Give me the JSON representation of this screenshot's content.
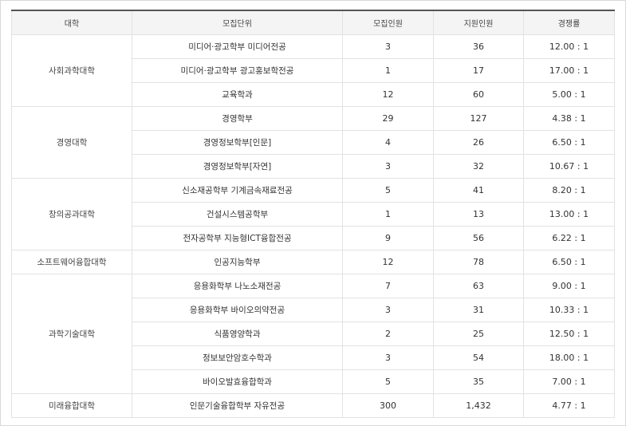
{
  "headers": [
    "대학",
    "모집단위",
    "모집인원",
    "지원인원",
    "경쟁률"
  ],
  "groups": [
    {
      "college": "사회과학대학",
      "rows": [
        {
          "unit": "미디어·광고학부 미디어전공",
          "quota": "3",
          "applicants": "36",
          "ratio": "12.00 : 1"
        },
        {
          "unit": "미디어·광고학부 광고홍보학전공",
          "quota": "1",
          "applicants": "17",
          "ratio": "17.00 : 1"
        },
        {
          "unit": "교육학과",
          "quota": "12",
          "applicants": "60",
          "ratio": "5.00 : 1"
        }
      ]
    },
    {
      "college": "경영대학",
      "rows": [
        {
          "unit": "경영학부",
          "quota": "29",
          "applicants": "127",
          "ratio": "4.38 : 1"
        },
        {
          "unit": "경영정보학부[인문]",
          "quota": "4",
          "applicants": "26",
          "ratio": "6.50 : 1"
        },
        {
          "unit": "경영정보학부[자연]",
          "quota": "3",
          "applicants": "32",
          "ratio": "10.67 : 1"
        }
      ]
    },
    {
      "college": "창의공과대학",
      "rows": [
        {
          "unit": "신소재공학부 기계금속재료전공",
          "quota": "5",
          "applicants": "41",
          "ratio": "8.20 : 1"
        },
        {
          "unit": "건설시스템공학부",
          "quota": "1",
          "applicants": "13",
          "ratio": "13.00 : 1"
        },
        {
          "unit": "전자공학부 지능형ICT융합전공",
          "quota": "9",
          "applicants": "56",
          "ratio": "6.22 : 1"
        }
      ]
    },
    {
      "college": "소프트웨어융합대학",
      "rows": [
        {
          "unit": "인공지능학부",
          "quota": "12",
          "applicants": "78",
          "ratio": "6.50 : 1"
        }
      ]
    },
    {
      "college": "과학기술대학",
      "rows": [
        {
          "unit": "응용화학부 나노소재전공",
          "quota": "7",
          "applicants": "63",
          "ratio": "9.00 : 1"
        },
        {
          "unit": "응용화학부 바이오의약전공",
          "quota": "3",
          "applicants": "31",
          "ratio": "10.33 : 1"
        },
        {
          "unit": "식품영양학과",
          "quota": "2",
          "applicants": "25",
          "ratio": "12.50 : 1"
        },
        {
          "unit": "정보보안암호수학과",
          "quota": "3",
          "applicants": "54",
          "ratio": "18.00 : 1"
        },
        {
          "unit": "바이오발효융합학과",
          "quota": "5",
          "applicants": "35",
          "ratio": "7.00 : 1"
        }
      ]
    },
    {
      "college": "미래융합대학",
      "rows": [
        {
          "unit": "인문기술융합학부 자유전공",
          "quota": "300",
          "applicants": "1,432",
          "ratio": "4.77 : 1"
        }
      ]
    }
  ]
}
